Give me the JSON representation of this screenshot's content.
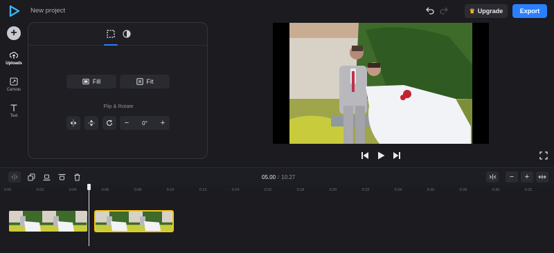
{
  "header": {
    "project_title": "New project",
    "upgrade_label": "Upgrade",
    "export_label": "Export"
  },
  "rail": {
    "items": [
      {
        "label": "Uploads",
        "icon": "upload-icon"
      },
      {
        "label": "Canvas",
        "icon": "canvas-icon"
      },
      {
        "label": "Text",
        "icon": "text-icon"
      }
    ]
  },
  "panel": {
    "tabs": [
      "crop-icon",
      "filter-icon"
    ],
    "fill_label": "Fill",
    "fit_label": "Fit",
    "flip_rotate_label": "Flip & Rotate",
    "rotation_value": "0°"
  },
  "timeline": {
    "current_time": "05.00",
    "separator": "/",
    "total_time": "10.27",
    "ticks": [
      "0:00",
      "0:02",
      "0:04",
      "0:06",
      "0:08",
      "0:10",
      "0:12",
      "0:14",
      "0:16",
      "0:18",
      "0:20",
      "0:22",
      "0:24",
      "0:26",
      "0:28",
      "0:30",
      "0:32"
    ]
  },
  "colors": {
    "accent": "#2a7fff",
    "selected_clip_border": "#f5c518",
    "background": "#1b1b20"
  }
}
